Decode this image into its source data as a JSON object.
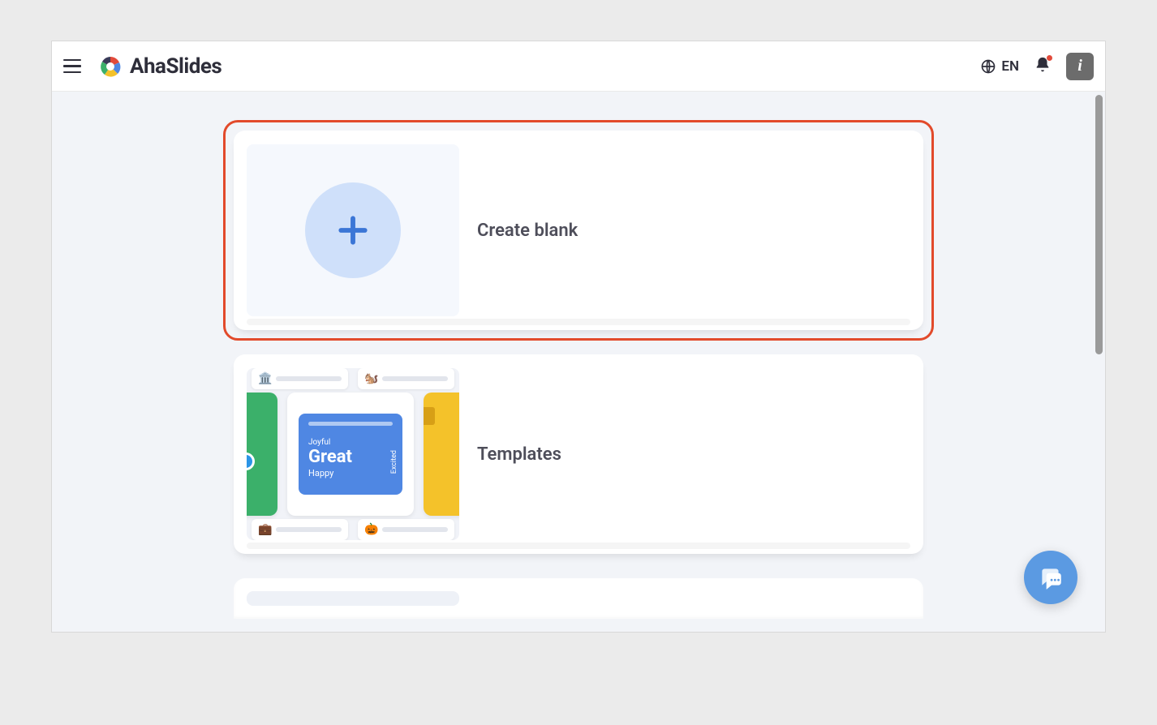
{
  "header": {
    "brand": "AhaSlides",
    "language_label": "EN"
  },
  "cards": {
    "create_blank": {
      "title": "Create blank"
    },
    "templates": {
      "title": "Templates",
      "preview_words": {
        "joyful": "Joyful",
        "great": "Great",
        "happy": "Happy",
        "excited": "Excited"
      }
    }
  }
}
